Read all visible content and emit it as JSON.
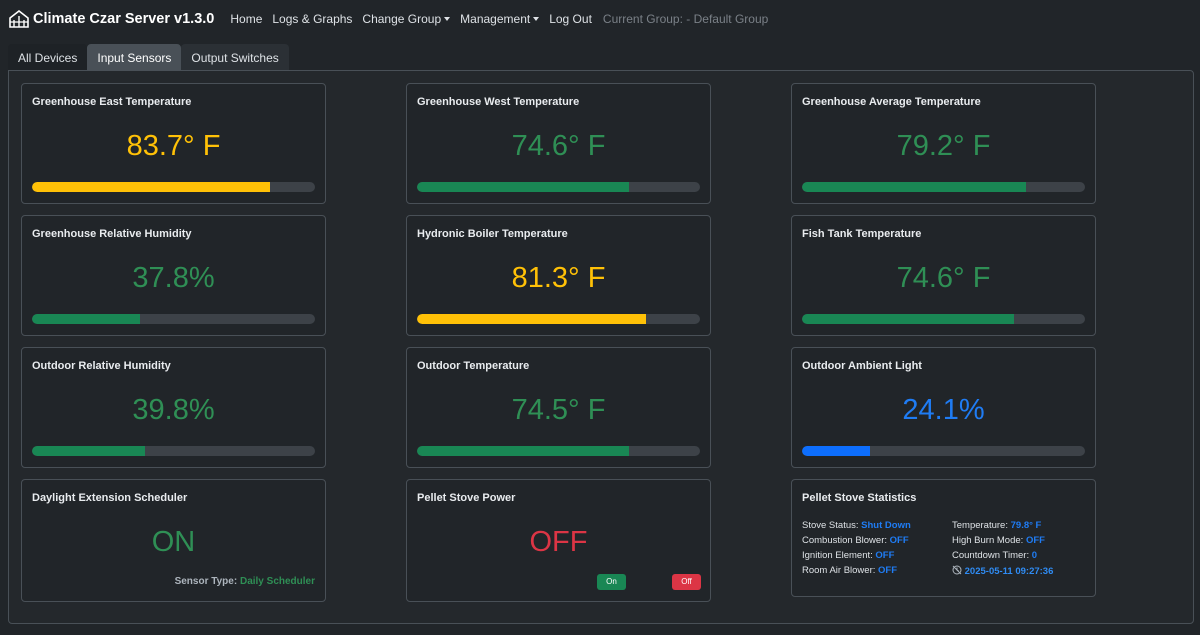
{
  "app": {
    "title": "Climate Czar Server v1.3.0"
  },
  "nav": {
    "home": "Home",
    "logs": "Logs & Graphs",
    "change_group": "Change Group",
    "management": "Management",
    "logout": "Log Out",
    "current_group": "Current Group: - Default Group"
  },
  "tabs": [
    "All Devices",
    "Input Sensors",
    "Output Switches"
  ],
  "active_tab": "Input Sensors",
  "colors": {
    "yellow": "#ffc107",
    "green": "#198754",
    "blue": "#0d6efd",
    "red": "#dc3545"
  },
  "cards": [
    {
      "title": "Greenhouse East Temperature",
      "value": "83.7° F",
      "level_percent": 84,
      "color": "yellow"
    },
    {
      "title": "Greenhouse West Temperature",
      "value": "74.6° F",
      "level_percent": 75,
      "color": "green"
    },
    {
      "title": "Greenhouse Average Temperature",
      "value": "79.2° F",
      "level_percent": 79,
      "color": "green"
    },
    {
      "title": "Greenhouse Relative Humidity",
      "value": "37.8%",
      "level_percent": 38,
      "color": "green"
    },
    {
      "title": "Hydronic Boiler Temperature",
      "value": "81.3° F",
      "level_percent": 81,
      "color": "yellow"
    },
    {
      "title": "Fish Tank Temperature",
      "value": "74.6° F",
      "level_percent": 75,
      "color": "green"
    },
    {
      "title": "Outdoor Relative Humidity",
      "value": "39.8%",
      "level_percent": 40,
      "color": "green"
    },
    {
      "title": "Outdoor Temperature",
      "value": "74.5° F",
      "level_percent": 75,
      "color": "green"
    },
    {
      "title": "Outdoor Ambient Light",
      "value": "24.1%",
      "level_percent": 24,
      "color": "blue"
    }
  ],
  "daylight": {
    "title": "Daylight Extension Scheduler",
    "state": "ON",
    "sensor_type_label": "Sensor Type:",
    "sensor_type": "Daily Scheduler"
  },
  "pellet_power": {
    "title": "Pellet Stove Power",
    "state": "OFF",
    "on_label": "On",
    "off_label": "Off"
  },
  "pellet_stats": {
    "title": "Pellet Stove Statistics",
    "stove_status_label": "Stove Status:",
    "stove_status": "Shut Down",
    "combustion_label": "Combustion Blower:",
    "combustion": "OFF",
    "ignition_label": "Ignition Element:",
    "ignition": "OFF",
    "room_air_label": "Room Air Blower:",
    "room_air": "OFF",
    "temperature_label": "Temperature:",
    "temperature": "79.8° F",
    "high_burn_label": "High Burn Mode:",
    "high_burn": "OFF",
    "countdown_label": "Countdown Timer:",
    "countdown": "0",
    "timestamp": "2025-05-11 09:27:36",
    "timestamp_icon": "clock-off-icon"
  }
}
